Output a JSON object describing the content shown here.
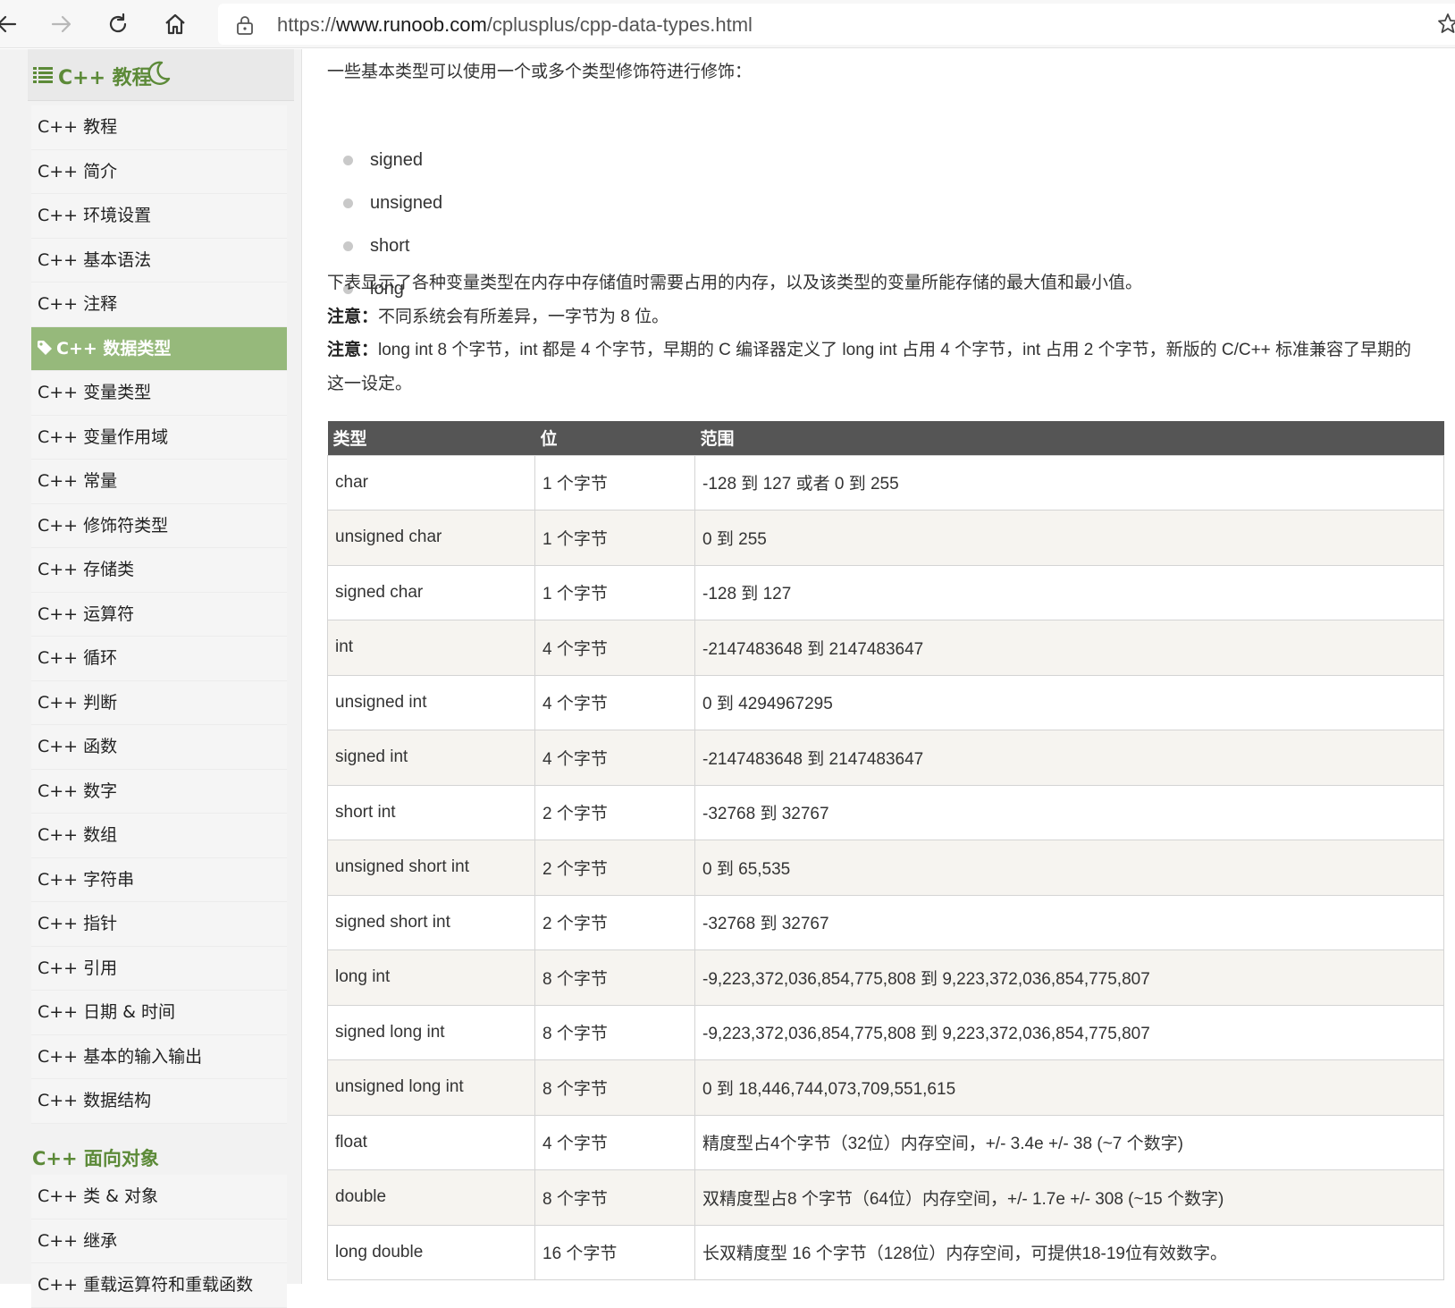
{
  "browser": {
    "url_prefix": "https://",
    "url_host": "www.runoob.com",
    "url_path": "/cplusplus/cpp-data-types.html"
  },
  "sidebar": {
    "title": "C++ 教程",
    "items": [
      {
        "label": "C++ 教程"
      },
      {
        "label": "C++ 简介"
      },
      {
        "label": "C++ 环境设置"
      },
      {
        "label": "C++ 基本语法"
      },
      {
        "label": "C++ 注释"
      },
      {
        "label": "C++ 数据类型",
        "active": true
      },
      {
        "label": "C++ 变量类型"
      },
      {
        "label": "C++ 变量作用域"
      },
      {
        "label": "C++ 常量"
      },
      {
        "label": "C++ 修饰符类型"
      },
      {
        "label": "C++ 存储类"
      },
      {
        "label": "C++ 运算符"
      },
      {
        "label": "C++ 循环"
      },
      {
        "label": "C++ 判断"
      },
      {
        "label": "C++ 函数"
      },
      {
        "label": "C++ 数字"
      },
      {
        "label": "C++ 数组"
      },
      {
        "label": "C++ 字符串"
      },
      {
        "label": "C++ 指针"
      },
      {
        "label": "C++ 引用"
      },
      {
        "label": "C++ 日期 & 时间"
      },
      {
        "label": "C++ 基本的输入输出"
      },
      {
        "label": "C++ 数据结构"
      }
    ],
    "section_title": "C++ 面向对象",
    "section_items": [
      {
        "label": "C++ 类 & 对象"
      },
      {
        "label": "C++ 继承"
      },
      {
        "label": "C++ 重载运算符和重载函数"
      }
    ]
  },
  "content": {
    "intro": "一些基本类型可以使用一个或多个类型修饰符进行修饰：",
    "modifiers": [
      "signed",
      "unsigned",
      "short",
      "long"
    ],
    "table_desc": "下表显示了各种变量类型在内存中存储值时需要占用的内存，以及该类型的变量所能存储的最大值和最小值。",
    "note_label": "注意：",
    "note1": "不同系统会有所差异，一字节为 8 位。",
    "note2_line1": "long int 8 个字节，int 都是 4 个字节，早期的 C 编译器定义了 long int 占用 4 个字节，int 占用 2 个字节，新版的 C/C++ 标准兼容了早期的",
    "note2_line2": "这一设定。",
    "table": {
      "headers": [
        "类型",
        "位",
        "范围"
      ],
      "rows": [
        [
          "char",
          "1 个字节",
          "-128 到 127 或者 0 到 255"
        ],
        [
          "unsigned char",
          "1 个字节",
          "0 到 255"
        ],
        [
          "signed char",
          "1 个字节",
          "-128 到 127"
        ],
        [
          "int",
          "4 个字节",
          "-2147483648 到 2147483647"
        ],
        [
          "unsigned int",
          "4 个字节",
          "0 到 4294967295"
        ],
        [
          "signed int",
          "4 个字节",
          "-2147483648 到 2147483647"
        ],
        [
          "short int",
          "2 个字节",
          "-32768 到 32767"
        ],
        [
          "unsigned short int",
          "2 个字节",
          "0 到 65,535"
        ],
        [
          "signed short int",
          "2 个字节",
          "-32768 到 32767"
        ],
        [
          "long int",
          "8 个字节",
          "-9,223,372,036,854,775,808 到 9,223,372,036,854,775,807"
        ],
        [
          "signed long int",
          "8 个字节",
          "-9,223,372,036,854,775,808 到 9,223,372,036,854,775,807"
        ],
        [
          "unsigned long int",
          "8 个字节",
          "0 到 18,446,744,073,709,551,615"
        ],
        [
          "float",
          "4 个字节",
          "精度型占4个字节（32位）内存空间，+/- 3.4e +/- 38 (~7 个数字)"
        ],
        [
          "double",
          "8 个字节",
          "双精度型占8 个字节（64位）内存空间，+/- 1.7e +/- 308 (~15 个数字)"
        ],
        [
          "long double",
          "16 个字节",
          "长双精度型 16 个字节（128位）内存空间，可提供18-19位有效数字。"
        ]
      ]
    }
  },
  "colors": {
    "accent_green": "#5c8a38",
    "active_item_bg": "#96b97b",
    "table_header_bg": "#555555"
  },
  "icons": [
    "back-icon",
    "forward-icon",
    "reload-icon",
    "home-icon",
    "lock-icon",
    "favorite-star-icon",
    "list-icon",
    "moon-icon",
    "tag-icon"
  ]
}
